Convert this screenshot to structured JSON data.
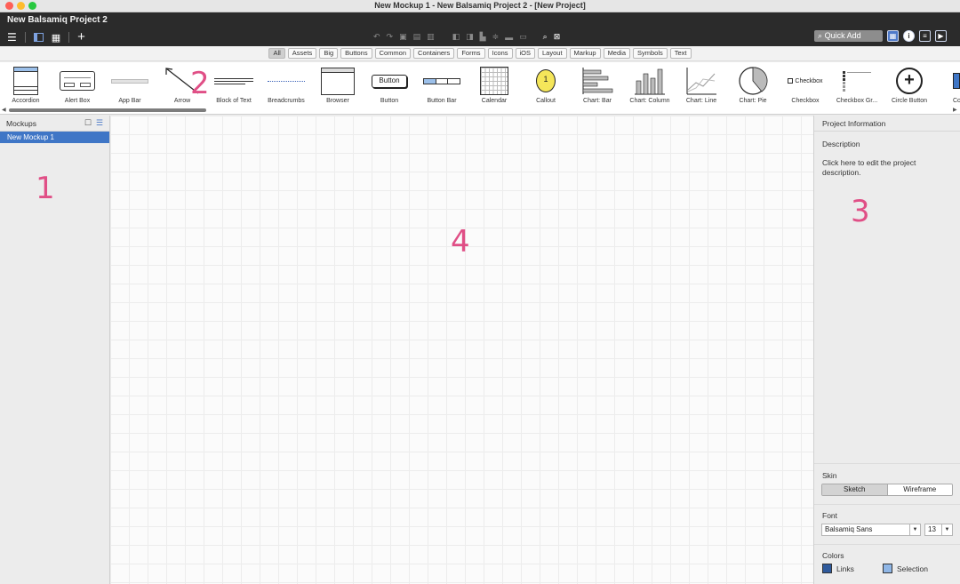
{
  "window": {
    "title": "New Mockup 1 - New Balsamiq Project 2 - [New Project]"
  },
  "header": {
    "project_name": "New Balsamiq Project 2",
    "menu_icon": "hamburger-icon",
    "quick_add_label": "Quick Add"
  },
  "filters": [
    "All",
    "Assets",
    "Big",
    "Buttons",
    "Common",
    "Containers",
    "Forms",
    "Icons",
    "iOS",
    "Layout",
    "Markup",
    "Media",
    "Symbols",
    "Text"
  ],
  "components": {
    "accordion": "Accordion",
    "alert_box": "Alert Box",
    "app_bar": "App Bar",
    "arrow": "Arrow",
    "block_text": "Block of Text",
    "breadcrumbs": "Breadcrumbs",
    "browser": "Browser",
    "button": "Button",
    "button_bar": "Button Bar",
    "calendar": "Calendar",
    "callout": "Callout",
    "chart_bar": "Chart: Bar",
    "chart_column": "Chart: Column",
    "chart_line": "Chart: Line",
    "chart_pie": "Chart: Pie",
    "checkbox": "Checkbox",
    "checkbox_group": "Checkbox Gr...",
    "circle_button": "Circle Button",
    "color_partial": "Colo",
    "button_thumb_text": "Button",
    "checkbox_thumb_text": "Checkbox",
    "callout_thumb_text": "1"
  },
  "left_panel": {
    "title": "Mockups",
    "items": [
      "New Mockup 1"
    ]
  },
  "right_panel": {
    "title": "Project Information",
    "description_label": "Description",
    "description_text": "Click here to edit the project description.",
    "skin_label": "Skin",
    "skin_options": [
      "Sketch",
      "Wireframe"
    ],
    "font_label": "Font",
    "font_value": "Balsamiq Sans",
    "font_size": "13",
    "colors_label": "Colors",
    "links_label": "Links",
    "selection_label": "Selection",
    "links_color": "#2f5a9c",
    "selection_color": "#8fb6e6"
  },
  "annotations": [
    "1",
    "2",
    "3",
    "4"
  ]
}
